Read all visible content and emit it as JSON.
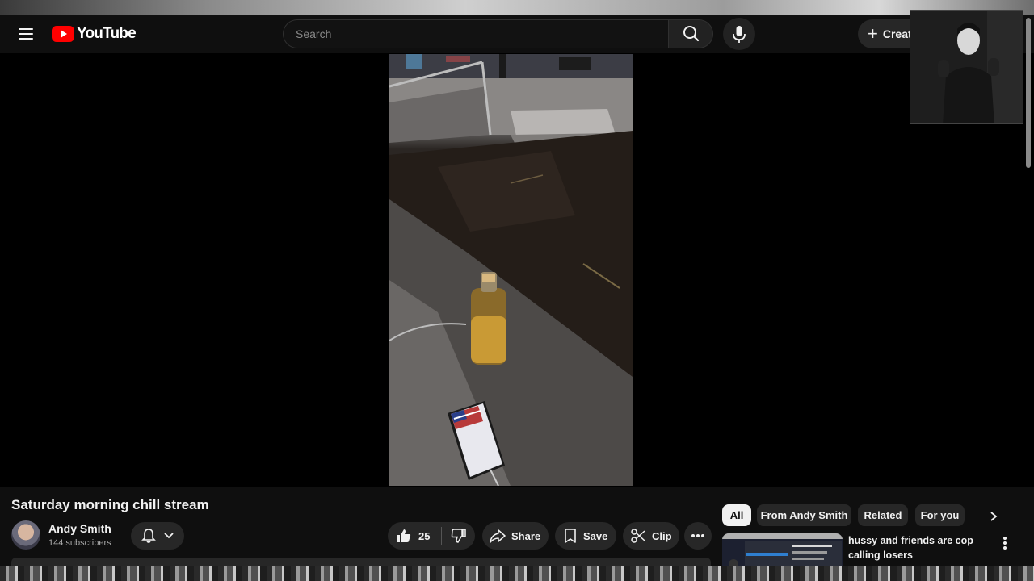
{
  "masthead": {
    "logo_text": "YouTube",
    "search_placeholder": "Search",
    "create_label": "Creat"
  },
  "video": {
    "title": "Saturday morning chill stream"
  },
  "channel": {
    "name": "Andy Smith",
    "subscribers": "144 subscribers"
  },
  "actions": {
    "like_count": "25",
    "share_label": "Share",
    "save_label": "Save",
    "clip_label": "Clip"
  },
  "sidebar": {
    "chips": [
      {
        "label": "All",
        "active": true
      },
      {
        "label": "From Andy Smith",
        "active": false
      },
      {
        "label": "Related",
        "active": false
      },
      {
        "label": "For you",
        "active": false
      }
    ],
    "recommendation": {
      "title": "hussy and friends are cop calling losers"
    }
  },
  "colors": {
    "background": "#0f0f0f",
    "logo_red": "#ff0000",
    "chip_active": "#f1f1f1",
    "button_bg": "#272727"
  },
  "icons": [
    "menu-icon",
    "youtube-logo-icon",
    "search-icon",
    "mic-icon",
    "plus-icon",
    "bell-icon",
    "chevron-down-icon",
    "thumbs-up-icon",
    "thumbs-down-icon",
    "share-icon",
    "bookmark-icon",
    "scissors-icon",
    "more-horizontal-icon",
    "chevron-right-icon",
    "more-vertical-icon"
  ]
}
